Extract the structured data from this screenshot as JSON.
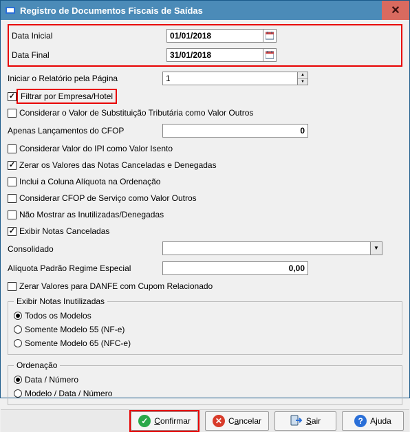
{
  "window": {
    "title": "Registro de Documentos Fiscais de Saídas"
  },
  "fields": {
    "dataInicial": {
      "label": "Data Inicial",
      "value": "01/01/2018"
    },
    "dataFinal": {
      "label": "Data Final",
      "value": "31/01/2018"
    },
    "iniciarPag": {
      "label": "Iniciar o Relatório pela Página",
      "value": "1"
    },
    "cfop": {
      "label": "Apenas Lançamentos do CFOP",
      "value": "0"
    },
    "consolidado": {
      "label": "Consolidado",
      "value": ""
    },
    "aliquota": {
      "label": "Alíquota Padrão Regime Especial",
      "value": "0,00"
    }
  },
  "checks": {
    "filtrarEmpresa": {
      "label": "Filtrar por Empresa/Hotel",
      "checked": true
    },
    "substTrib": {
      "label": "Considerar o Valor de Substituição Tributária como Valor Outros",
      "checked": false
    },
    "ipiIsento": {
      "label": "Considerar Valor do IPI como Valor Isento",
      "checked": false
    },
    "zerarCancDen": {
      "label": "Zerar os Valores das Notas Canceladas e Denegadas",
      "checked": true
    },
    "colAliqOrden": {
      "label": "Inclui a Coluna Alíquota na Ordenação",
      "checked": false
    },
    "cfopServOutros": {
      "label": "Considerar CFOP de Serviço como Valor Outros",
      "checked": false
    },
    "naoMostrarInut": {
      "label": "Não Mostrar as Inutilizadas/Denegadas",
      "checked": false
    },
    "exibirCanceladas": {
      "label": "Exibir Notas Canceladas",
      "checked": true
    },
    "zerarDanfe": {
      "label": "Zerar Valores para DANFE com Cupom Relacionado",
      "checked": false
    }
  },
  "groups": {
    "inutilizadas": {
      "legend": "Exibir Notas Inutilizadas",
      "options": {
        "todos": {
          "label": "Todos os Modelos",
          "selected": true
        },
        "m55": {
          "label": "Somente Modelo 55 (NF-e)",
          "selected": false
        },
        "m65": {
          "label": "Somente Modelo 65 (NFC-e)",
          "selected": false
        }
      }
    },
    "ordenacao": {
      "legend": "Ordenação",
      "options": {
        "dataNum": {
          "label": "Data / Número",
          "selected": true
        },
        "modDataNum": {
          "label": "Modelo / Data / Número",
          "selected": false
        }
      }
    }
  },
  "buttons": {
    "confirmar": "Confirmar",
    "cancelar": "Cancelar",
    "sair": "Sair",
    "ajuda": "Ajuda"
  }
}
